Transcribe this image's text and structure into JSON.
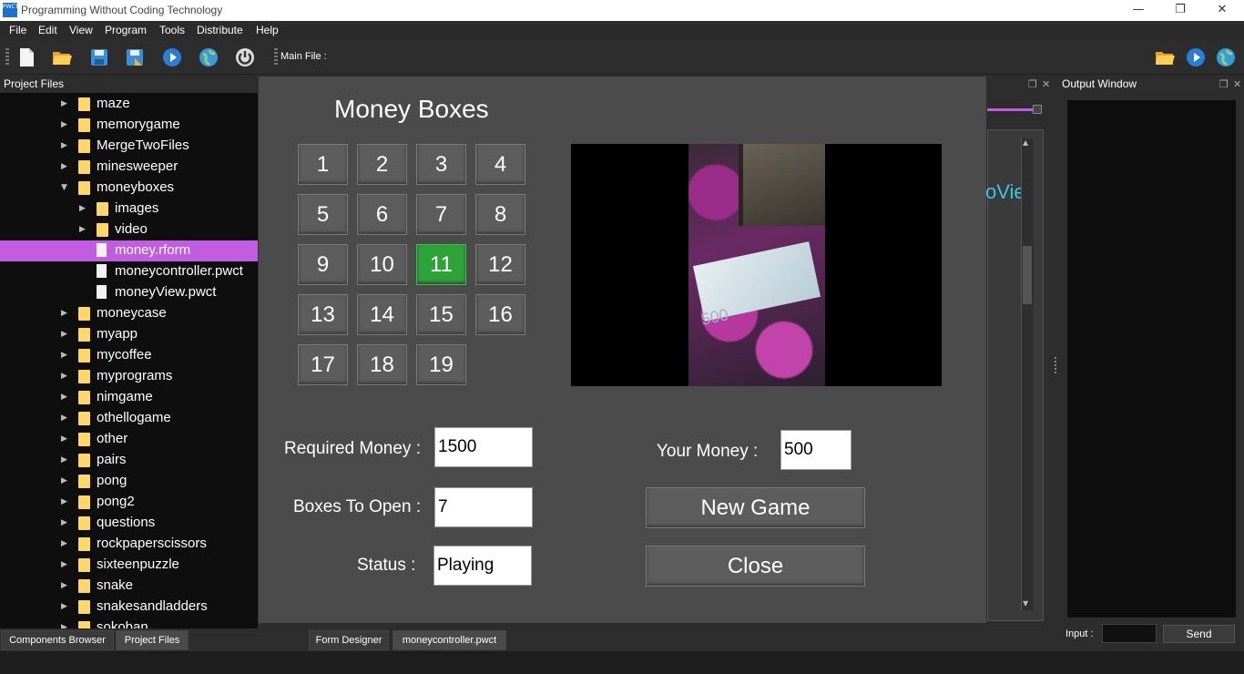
{
  "window": {
    "title": "Programming Without Coding Technology",
    "app_icon_text": "PWCT",
    "minimize_glyph": "—",
    "restore_glyph": "❐",
    "close_glyph": "✕"
  },
  "menu": [
    "File",
    "Edit",
    "View",
    "Program",
    "Tools",
    "Distribute",
    "Help"
  ],
  "toolbar": {
    "main_file_label": "Main File :"
  },
  "left_panel": {
    "title": "Project Files",
    "tree": [
      {
        "label": "maze",
        "type": "folder",
        "level": 0,
        "expanded": false
      },
      {
        "label": "memorygame",
        "type": "folder",
        "level": 0,
        "expanded": false
      },
      {
        "label": "MergeTwoFiles",
        "type": "folder",
        "level": 0,
        "expanded": false
      },
      {
        "label": "minesweeper",
        "type": "folder",
        "level": 0,
        "expanded": false
      },
      {
        "label": "moneyboxes",
        "type": "folder",
        "level": 0,
        "expanded": true
      },
      {
        "label": "images",
        "type": "folder",
        "level": 1,
        "expanded": false
      },
      {
        "label": "video",
        "type": "folder",
        "level": 1,
        "expanded": false
      },
      {
        "label": "money.rform",
        "type": "file",
        "level": 1,
        "selected": true
      },
      {
        "label": "moneycontroller.pwct",
        "type": "file",
        "level": 1
      },
      {
        "label": "moneyView.pwct",
        "type": "file",
        "level": 1
      },
      {
        "label": "moneycase",
        "type": "folder",
        "level": 0,
        "expanded": false
      },
      {
        "label": "myapp",
        "type": "folder",
        "level": 0,
        "expanded": false
      },
      {
        "label": "mycoffee",
        "type": "folder",
        "level": 0,
        "expanded": false
      },
      {
        "label": "myprograms",
        "type": "folder",
        "level": 0,
        "expanded": false
      },
      {
        "label": "nimgame",
        "type": "folder",
        "level": 0,
        "expanded": false
      },
      {
        "label": "othellogame",
        "type": "folder",
        "level": 0,
        "expanded": false
      },
      {
        "label": "other",
        "type": "folder",
        "level": 0,
        "expanded": false
      },
      {
        "label": "pairs",
        "type": "folder",
        "level": 0,
        "expanded": false
      },
      {
        "label": "pong",
        "type": "folder",
        "level": 0,
        "expanded": false
      },
      {
        "label": "pong2",
        "type": "folder",
        "level": 0,
        "expanded": false
      },
      {
        "label": "questions",
        "type": "folder",
        "level": 0,
        "expanded": false
      },
      {
        "label": "rockpaperscissors",
        "type": "folder",
        "level": 0,
        "expanded": false
      },
      {
        "label": "sixteenpuzzle",
        "type": "folder",
        "level": 0,
        "expanded": false
      },
      {
        "label": "snake",
        "type": "folder",
        "level": 0,
        "expanded": false
      },
      {
        "label": "snakesandladders",
        "type": "folder",
        "level": 0,
        "expanded": false
      },
      {
        "label": "sokoban",
        "type": "folder",
        "level": 0,
        "expanded": false
      }
    ],
    "tabs": [
      "Components Browser",
      "Project Files"
    ]
  },
  "editor": {
    "partial_text": "oVie",
    "tabs": [
      "Form Designer",
      "moneycontroller.pwct"
    ]
  },
  "output": {
    "title": "Output Window",
    "input_label": "Input :",
    "send_label": "Send"
  },
  "form": {
    "title": "Money Boxes",
    "boxes": [
      "1",
      "2",
      "3",
      "4",
      "5",
      "6",
      "7",
      "8",
      "9",
      "10",
      "11",
      "12",
      "13",
      "14",
      "15",
      "16",
      "17",
      "18",
      "19"
    ],
    "active_box": "11",
    "video_note_value": "500",
    "required_money_label": "Required Money :",
    "required_money_value": "1500",
    "boxes_to_open_label": "Boxes To Open :",
    "boxes_to_open_value": "7",
    "status_label": "Status :",
    "status_value": "Playing",
    "your_money_label": "Your Money :",
    "your_money_value": "500",
    "new_game_label": "New Game",
    "close_label": "Close"
  },
  "colors": {
    "selected_row": "#c15de0",
    "active_box": "#2ea33a",
    "accent_text": "#3cc3e6"
  }
}
